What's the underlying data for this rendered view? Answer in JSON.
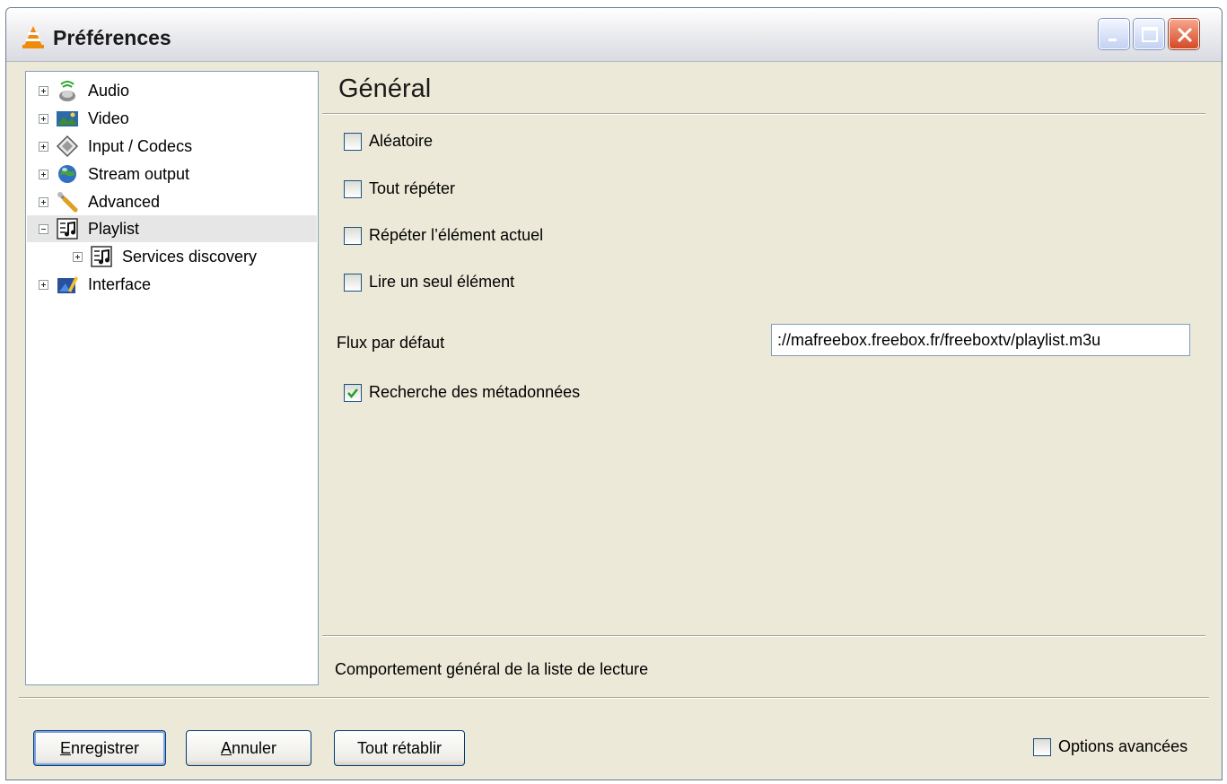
{
  "window": {
    "title": "Préférences"
  },
  "tree": {
    "items": [
      {
        "label": "Audio",
        "icon": "audio-icon",
        "expander": "plus"
      },
      {
        "label": "Video",
        "icon": "video-icon",
        "expander": "plus"
      },
      {
        "label": "Input / Codecs",
        "icon": "input-codecs-icon",
        "expander": "plus"
      },
      {
        "label": "Stream output",
        "icon": "stream-output-icon",
        "expander": "plus"
      },
      {
        "label": "Advanced",
        "icon": "advanced-icon",
        "expander": "plus"
      },
      {
        "label": "Playlist",
        "icon": "playlist-icon",
        "expander": "minus",
        "selected": true
      },
      {
        "label": "Services discovery",
        "icon": "services-discovery-icon",
        "expander": "plus"
      },
      {
        "label": "Interface",
        "icon": "interface-icon",
        "expander": "plus"
      }
    ]
  },
  "panel": {
    "title": "Général",
    "options": [
      {
        "label": "Aléatoire",
        "checked": false
      },
      {
        "label": "Tout répéter",
        "checked": false
      },
      {
        "label": "Répéter l’élément actuel",
        "checked": false
      },
      {
        "label": "Lire un seul élément",
        "checked": false
      }
    ],
    "default_stream": {
      "label": "Flux par défaut",
      "value": "://mafreebox.freebox.fr/freeboxtv/playlist.m3u"
    },
    "metadata": {
      "label": "Recherche des métadonnées",
      "checked": true
    },
    "status": "Comportement général de la liste de lecture"
  },
  "buttons": {
    "save": {
      "mnemonic": "E",
      "rest": "nregistrer"
    },
    "cancel": {
      "mnemonic": "A",
      "rest": "nnuler"
    },
    "reset": "Tout rétablir"
  },
  "advanced_options": {
    "label": "Options avancées",
    "checked": false
  },
  "colors": {
    "accent": "#316ac5",
    "check": "#21a121",
    "close": "#d44a25"
  }
}
